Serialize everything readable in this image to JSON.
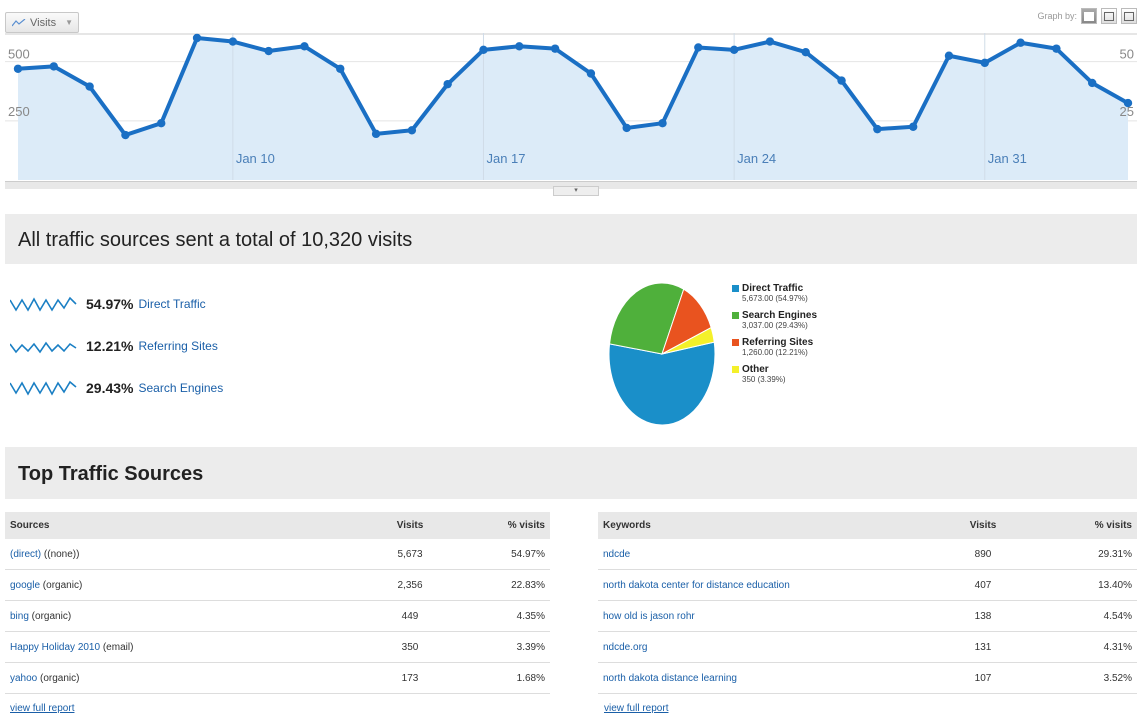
{
  "top_chart": {
    "metric_button": "Visits",
    "graph_by_label": "Graph by:",
    "y_ticks": [
      "500",
      "250"
    ],
    "y_ticks_right": [
      "50",
      "25"
    ],
    "x_labels": [
      "Jan 10",
      "Jan 17",
      "Jan 24",
      "Jan 31"
    ],
    "line_color": "#1a6fc4",
    "fill_color": "#dcebf8"
  },
  "chart_data": [
    {
      "type": "area",
      "x": [
        "Jan 3",
        "Jan 4",
        "Jan 5",
        "Jan 6",
        "Jan 7",
        "Jan 8",
        "Jan 9",
        "Jan 10",
        "Jan 11",
        "Jan 12",
        "Jan 13",
        "Jan 14",
        "Jan 15",
        "Jan 16",
        "Jan 17",
        "Jan 18",
        "Jan 19",
        "Jan 20",
        "Jan 21",
        "Jan 22",
        "Jan 23",
        "Jan 24",
        "Jan 25",
        "Jan 26",
        "Jan 27",
        "Jan 28",
        "Jan 29",
        "Jan 30",
        "Jan 31",
        "Feb 1",
        "Feb 2",
        "Feb 3"
      ],
      "series": [
        {
          "values": [
            470,
            480,
            395,
            190,
            240,
            600,
            585,
            545,
            565,
            470,
            195,
            210,
            405,
            550,
            565,
            555,
            450,
            220,
            240,
            560,
            550,
            585,
            540,
            420,
            215,
            225,
            525,
            495,
            580,
            555,
            410,
            325
          ]
        }
      ],
      "ylim": [
        0,
        600
      ],
      "y_ticks": [
        250,
        500
      ],
      "grid": true
    },
    {
      "type": "pie",
      "categories": [
        "Direct Traffic",
        "Search Engines",
        "Referring Sites",
        "Other"
      ],
      "values": [
        5673,
        3037,
        1260,
        350
      ],
      "value_labels": [
        "5,673.00 (54.97%)",
        "3,037.00 (29.43%)",
        "1,260.00 (12.21%)",
        "350 (3.39%)"
      ],
      "colors": [
        "#1a8fc9",
        "#4fb03b",
        "#e9531f",
        "#f4f02a"
      ],
      "legend": "right"
    }
  ],
  "summary": {
    "title": "All traffic sources sent a total of 10,320 visits",
    "rows": [
      {
        "pct": "54.97%",
        "label": "Direct Traffic"
      },
      {
        "pct": "12.21%",
        "label": "Referring Sites"
      },
      {
        "pct": "29.43%",
        "label": "Search Engines"
      }
    ],
    "spark_color": "#1a7fc4"
  },
  "top_sources": {
    "title": "Top Traffic Sources",
    "sources": {
      "headers": [
        "Sources",
        "Visits",
        "% visits"
      ],
      "rows": [
        {
          "link": "(direct)",
          "rest": " ((none))",
          "visits": "5,673",
          "pct": "54.97%"
        },
        {
          "link": "google",
          "rest": " (organic)",
          "visits": "2,356",
          "pct": "22.83%"
        },
        {
          "link": "bing",
          "rest": " (organic)",
          "visits": "449",
          "pct": "4.35%"
        },
        {
          "link": "Happy Holiday 2010",
          "rest": " (email)",
          "visits": "350",
          "pct": "3.39%"
        },
        {
          "link": "yahoo",
          "rest": " (organic)",
          "visits": "173",
          "pct": "1.68%"
        }
      ],
      "view_full": "view full report"
    },
    "keywords": {
      "headers": [
        "Keywords",
        "Visits",
        "% visits"
      ],
      "rows": [
        {
          "link": "ndcde",
          "visits": "890",
          "pct": "29.31%"
        },
        {
          "link": "north dakota center for distance education",
          "visits": "407",
          "pct": "13.40%"
        },
        {
          "link": "how old is jason rohr",
          "visits": "138",
          "pct": "4.54%"
        },
        {
          "link": "ndcde.org",
          "visits": "131",
          "pct": "4.31%"
        },
        {
          "link": "north dakota distance learning",
          "visits": "107",
          "pct": "3.52%"
        }
      ],
      "view_full": "view full report"
    }
  }
}
